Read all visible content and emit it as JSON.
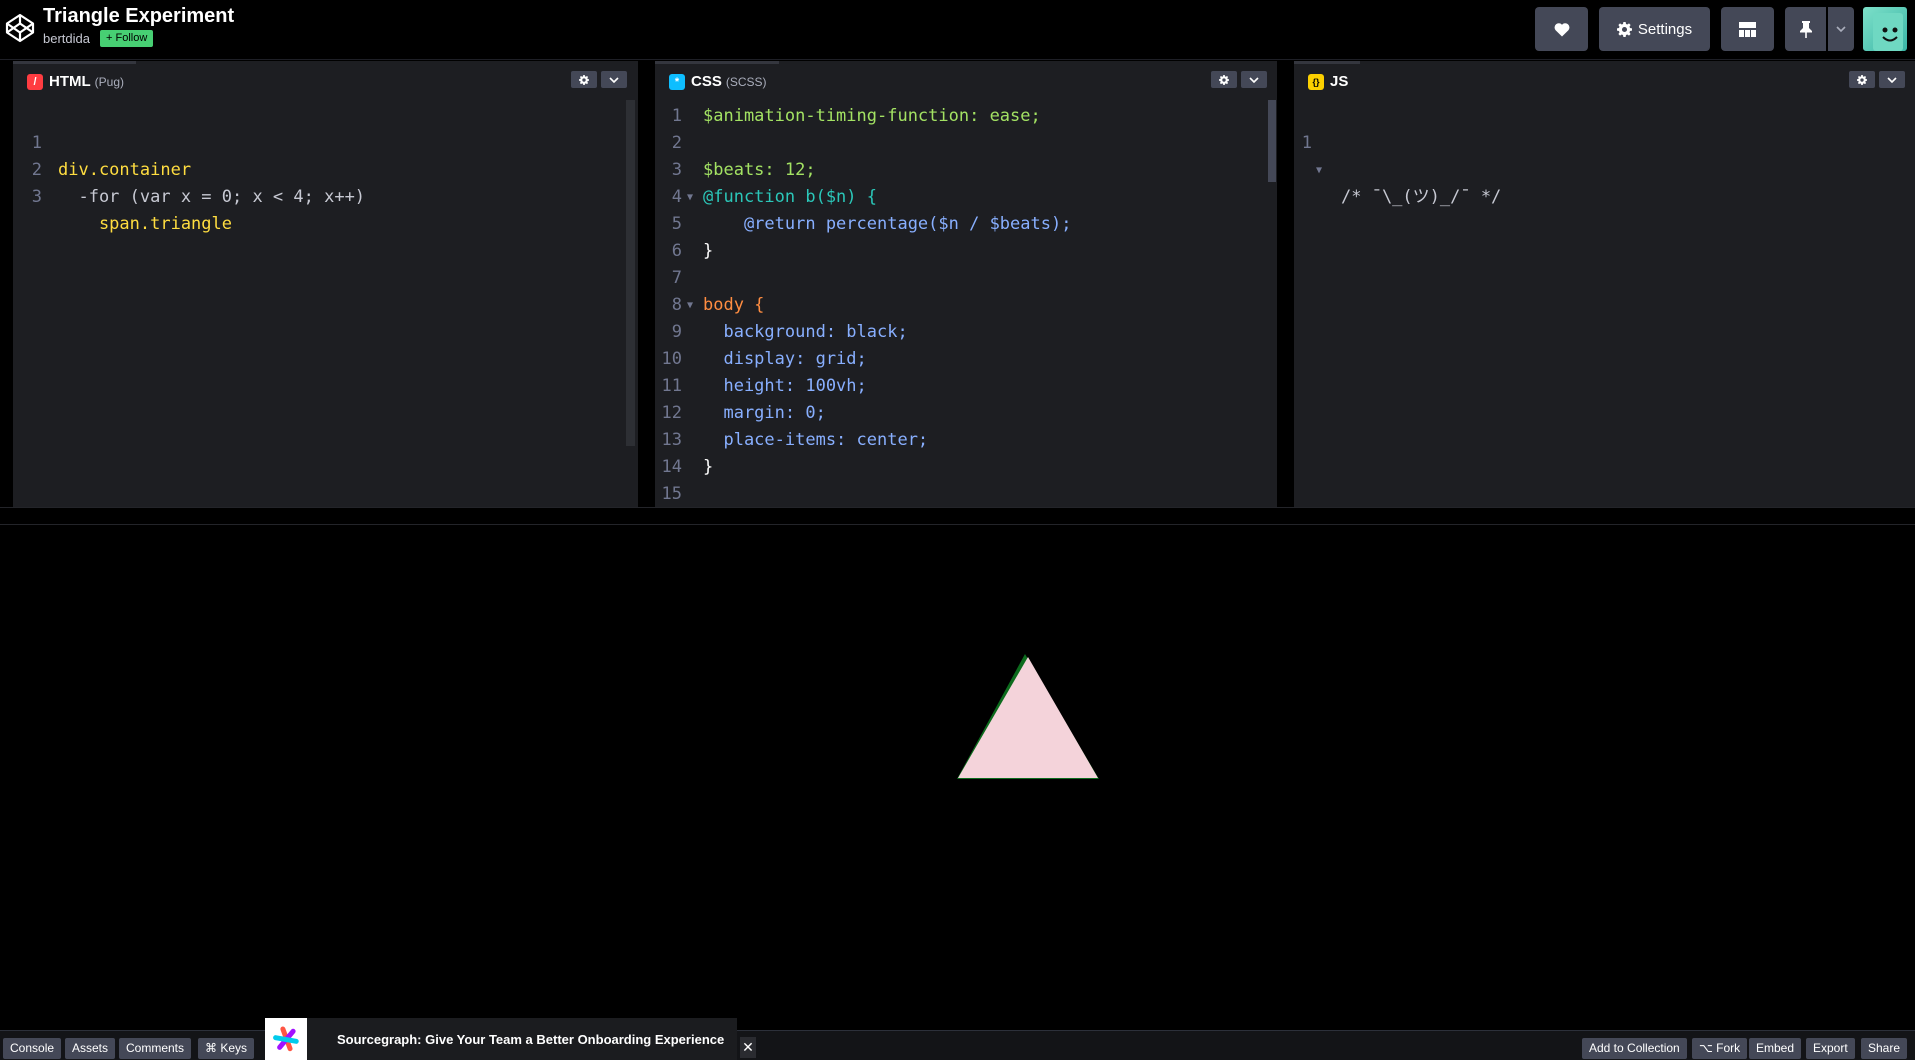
{
  "header": {
    "title": "Triangle Experiment",
    "author": "bertdida",
    "follow_label": "+ Follow",
    "settings_label": "Settings"
  },
  "panels": {
    "html": {
      "name": "HTML",
      "sub": "(Pug)",
      "icon": "/"
    },
    "css": {
      "name": "CSS",
      "sub": "(SCSS)",
      "icon": "*"
    },
    "js": {
      "name": "JS",
      "sub": "",
      "icon": "{}"
    }
  },
  "html_code": [
    {
      "n": "1",
      "t": "div.container"
    },
    {
      "n": "2",
      "t": "  -for (var x = 0; x < 4; x++)"
    },
    {
      "n": "3",
      "t": "    span.triangle"
    }
  ],
  "css_code": [
    {
      "n": "1",
      "t": "$animation-timing-function: ease;"
    },
    {
      "n": "2",
      "t": ""
    },
    {
      "n": "3",
      "t": "$beats: 12;"
    },
    {
      "n": "4",
      "t": "@function b($n) {"
    },
    {
      "n": "5",
      "t": "    @return percentage($n / $beats);"
    },
    {
      "n": "6",
      "t": "}"
    },
    {
      "n": "7",
      "t": ""
    },
    {
      "n": "8",
      "t": "body {"
    },
    {
      "n": "9",
      "t": "  background: black;"
    },
    {
      "n": "10",
      "t": "  display: grid;"
    },
    {
      "n": "11",
      "t": "  height: 100vh;"
    },
    {
      "n": "12",
      "t": "  margin: 0;"
    },
    {
      "n": "13",
      "t": "  place-items: center;"
    },
    {
      "n": "14",
      "t": "}"
    },
    {
      "n": "15",
      "t": ""
    }
  ],
  "js_code": [
    {
      "n": "1",
      "t": "/* ¯\\_(ツ)_/¯ */"
    }
  ],
  "footer": {
    "console": "Console",
    "assets": "Assets",
    "comments": "Comments",
    "keys": "⌘ Keys",
    "add_collection": "Add to Collection",
    "fork": "⌥ Fork",
    "embed": "Embed",
    "export": "Export",
    "share": "Share"
  },
  "ad": {
    "text": "Sourcegraph: Give Your Team a Better Onboarding Experience",
    "close": "✕"
  },
  "colors": {
    "accent_green": "#47cf73",
    "triangle_fill": "#f4d3da",
    "triangle_shadow": "#0c6b1d"
  }
}
